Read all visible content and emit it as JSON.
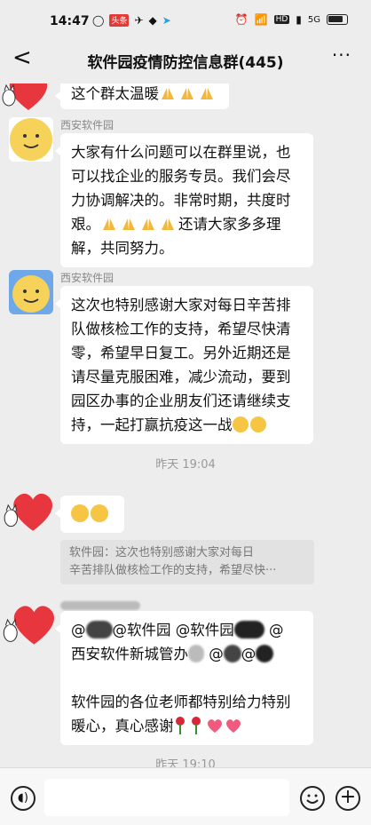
{
  "status_bar": {
    "time": "14:47",
    "left_icons": [
      "notification-icon",
      "app-icon",
      "app-icon",
      "app-icon",
      "telegram-icon"
    ],
    "hd_label": "HD",
    "net_label": "5G"
  },
  "nav": {
    "back_label": "<",
    "title": "软件园疫情防控信息群(445)",
    "more_label": "···"
  },
  "messages": [
    {
      "text": "这个群太温暖"
    },
    {
      "sender": "西安软件园",
      "text_lines": [
        "大家有什么问题可以在群里说，也",
        "可以找企业的服务专员。我们会尽",
        "力协调解决的。非常时期，共度时",
        "艰。",
        "还请大家多多理",
        "解，共同努力。"
      ]
    },
    {
      "sender": "西安软件园",
      "text_lines": [
        "这次也特别感谢大家对每日辛苦排",
        "队做核检工作的支持，希望尽快清",
        "零，希望早日复工。另外近期还是",
        "请尽量克服困难，减少流动，要到",
        "园区办事的企业朋友们还请继续支",
        "持，一起打赢抗疫这一战"
      ]
    },
    {
      "time": "昨天 19:04"
    },
    {
      "quote_lines": [
        "软件园：这次也特别感谢大家对每日",
        "辛苦排队做核检工作的支持，希望尽快···"
      ]
    },
    {
      "text_lines": [
        "@软件园 @软件园",
        "西安软件新城管办",
        "",
        "软件园的各位老师都特别给力特别",
        "暖心，真心感谢"
      ]
    },
    {
      "time": "昨天 19:10"
    }
  ],
  "emoji_names": [
    "pray-emoji",
    "grin-emoji",
    "salute-emoji",
    "rose-emoji",
    "heart-emoji"
  ],
  "colors": {
    "bg": "#ededed",
    "bubble": "#ffffff",
    "quote": "#e2e2e2"
  }
}
